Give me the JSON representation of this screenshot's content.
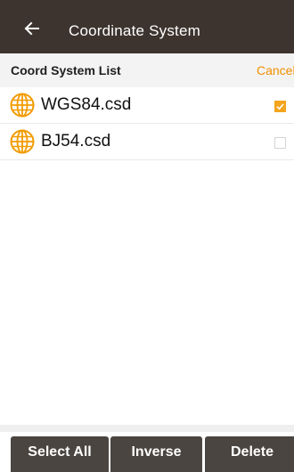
{
  "header": {
    "title": "Coordinate System"
  },
  "subheader": {
    "title": "Coord System List",
    "cancel_label": "Cancel"
  },
  "list": {
    "items": [
      {
        "label": "WGS84.csd",
        "icon": "globe-icon",
        "checked": true
      },
      {
        "label": "BJ54.csd",
        "icon": "globe-icon",
        "checked": false
      }
    ]
  },
  "footer": {
    "select_all_label": "Select All",
    "inverse_label": "Inverse",
    "delete_label": "Delete"
  },
  "colors": {
    "topbar_bg": "#3d342f",
    "accent": "#f08f00",
    "checkbox_checked": "#f3a51e",
    "button_bg": "#4a4541"
  }
}
